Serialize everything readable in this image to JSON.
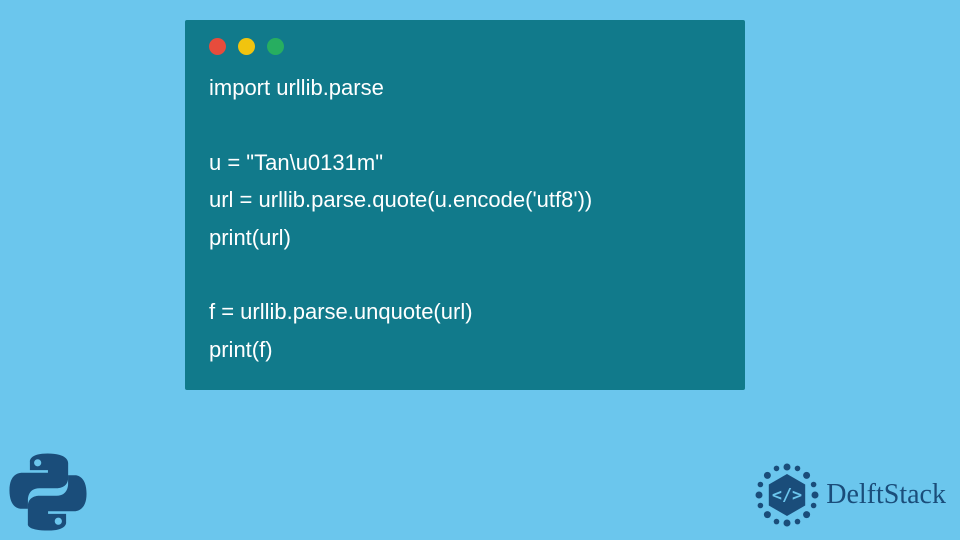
{
  "code": {
    "lines": [
      "import urllib.parse",
      "",
      "u = \"Tan\\u0131m\"",
      "url = urllib.parse.quote(u.encode('utf8'))",
      "print(url)",
      "",
      "f = urllib.parse.unquote(url)",
      "print(f)"
    ]
  },
  "branding": {
    "name": "DelftStack"
  },
  "colors": {
    "background": "#6bc6ed",
    "window": "#117a8b",
    "text": "#ffffff",
    "red": "#e74c3c",
    "yellow": "#f1c40f",
    "green": "#27ae60",
    "brand": "#1a4d7a"
  }
}
